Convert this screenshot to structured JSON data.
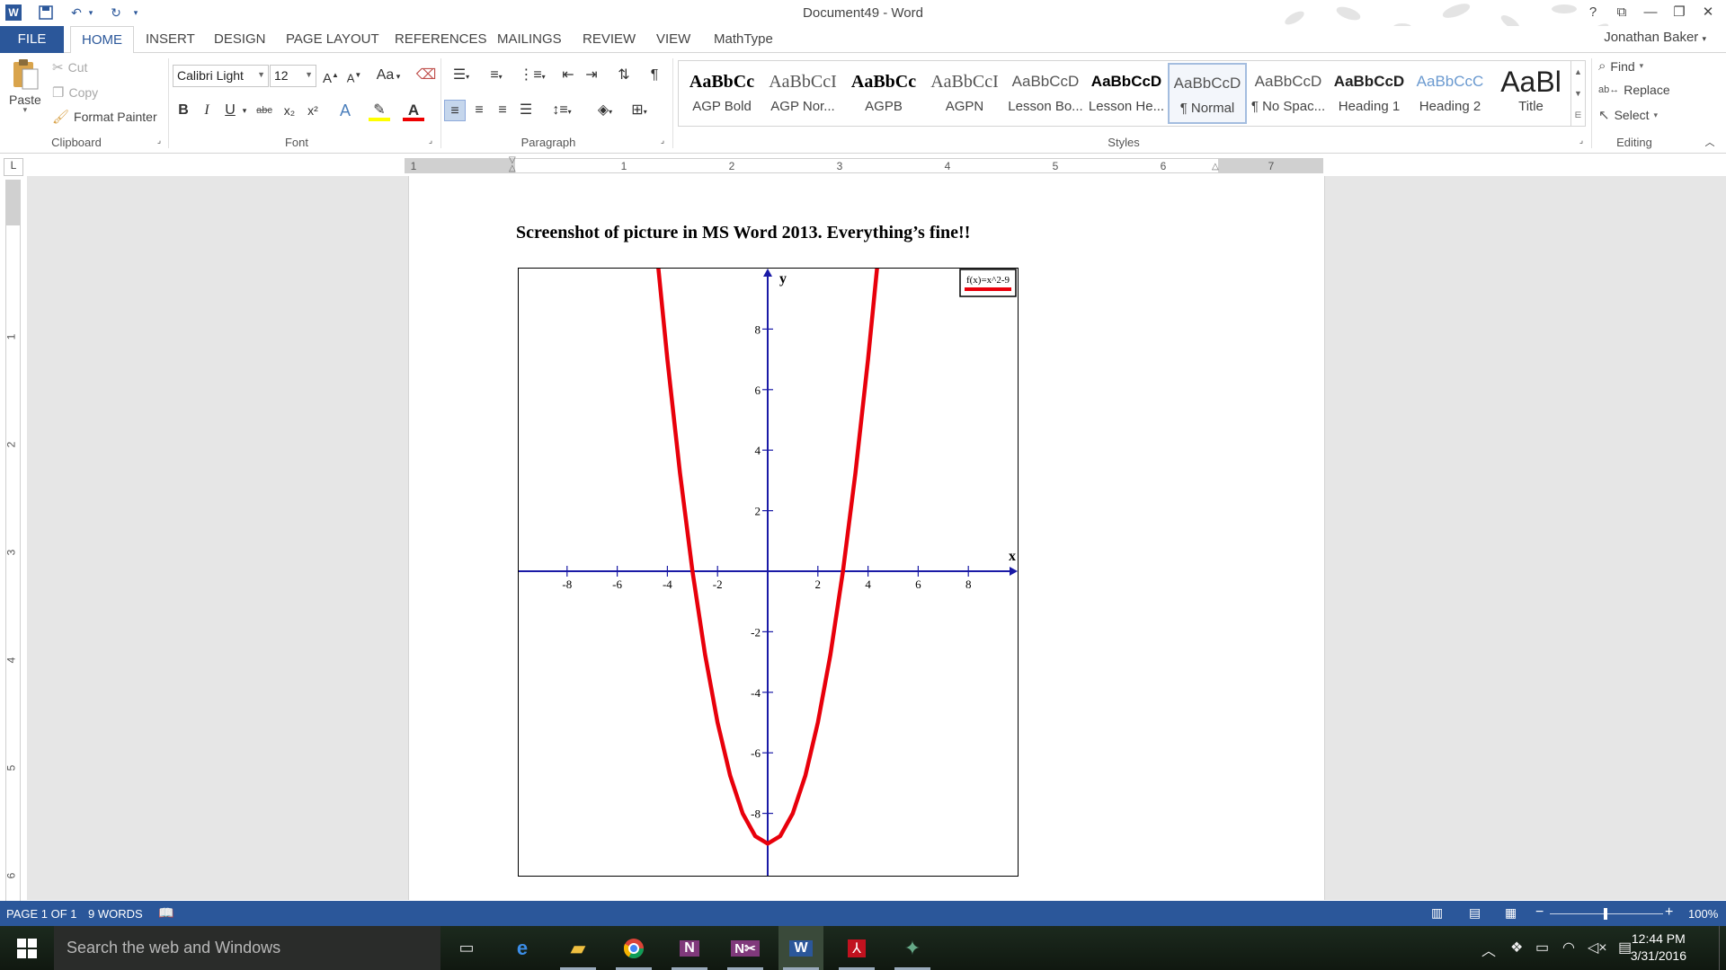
{
  "window": {
    "title": "Document49 - Word",
    "controls": [
      "?",
      "⧉",
      "—",
      "❐",
      "✕"
    ]
  },
  "tabs": {
    "file": "FILE",
    "items": [
      "HOME",
      "INSERT",
      "DESIGN",
      "PAGE LAYOUT",
      "REFERENCES",
      "MAILINGS",
      "REVIEW",
      "VIEW",
      "MathType"
    ],
    "active": "HOME",
    "user": "Jonathan Baker"
  },
  "clipboard": {
    "paste": "Paste",
    "cut": "Cut",
    "copy": "Copy",
    "format_painter": "Format Painter",
    "label": "Clipboard"
  },
  "font": {
    "name": "Calibri Light",
    "size": "12",
    "label": "Font",
    "case_btn": "Aa",
    "grow": "A",
    "shrink": "A",
    "bold": "B",
    "italic": "I",
    "underline": "U",
    "strike": "abc",
    "sub": "x₂",
    "sup": "x²"
  },
  "paragraph": {
    "label": "Paragraph"
  },
  "styles": {
    "label": "Styles",
    "items": [
      {
        "preview": "AaBbCc",
        "name": "AGP Bold"
      },
      {
        "preview": "AaBbCcI",
        "name": "AGP Nor..."
      },
      {
        "preview": "AaBbCc",
        "name": "AGPB"
      },
      {
        "preview": "AaBbCcI",
        "name": "AGPN"
      },
      {
        "preview": "AaBbCcD",
        "name": "Lesson Bo..."
      },
      {
        "preview": "AaBbCcD",
        "name": "Lesson He..."
      },
      {
        "preview": "AaBbCcD",
        "name": "¶ Normal"
      },
      {
        "preview": "AaBbCcD",
        "name": "¶ No Spac..."
      },
      {
        "preview": "AaBbCcD",
        "name": "Heading 1"
      },
      {
        "preview": "AaBbCcC",
        "name": "Heading 2"
      },
      {
        "preview": "AaBl",
        "name": "Title"
      }
    ],
    "selected": "¶ Normal"
  },
  "editing": {
    "find": "Find",
    "replace": "Replace",
    "select": "Select",
    "label": "Editing"
  },
  "ruler": {
    "h_numbers": [
      "1",
      "1",
      "2",
      "3",
      "4",
      "5",
      "6",
      "7"
    ],
    "v_numbers": [
      "1",
      "2",
      "3",
      "4",
      "5",
      "6"
    ],
    "corner": "L"
  },
  "document": {
    "heading": "Screenshot of picture in MS Word 2013. Everything’s fine!!"
  },
  "chart_data": {
    "type": "line",
    "function": "f(x)=x^2-9",
    "legend": "f(x)=x^2-9",
    "legend_placement": "top-right",
    "xlabel": "x",
    "ylabel": "y",
    "xlim": [
      -10,
      10
    ],
    "ylim": [
      -10,
      10
    ],
    "x_ticks": [
      -8,
      -6,
      -4,
      -2,
      2,
      4,
      6,
      8
    ],
    "y_ticks": [
      -8,
      -6,
      -4,
      -2,
      2,
      4,
      6,
      8
    ],
    "series": [
      {
        "name": "f(x)=x^2-9",
        "color": "#e8000b",
        "x": [
          -4.36,
          -4,
          -3.5,
          -3,
          -2.5,
          -2,
          -1.5,
          -1,
          -0.5,
          0,
          0.5,
          1,
          1.5,
          2,
          2.5,
          3,
          3.5,
          4,
          4.36
        ],
        "y": [
          10,
          7,
          3.25,
          0,
          -2.75,
          -5,
          -6.75,
          -8,
          -8.75,
          -9,
          -8.75,
          -8,
          -6.75,
          -5,
          -2.75,
          0,
          3.25,
          7,
          10
        ]
      }
    ],
    "axis_color": "#1a1aa6",
    "grid": false
  },
  "status": {
    "page": "PAGE 1 OF 1",
    "words": "9 WORDS",
    "zoom": "100%"
  },
  "taskbar": {
    "search_placeholder": "Search the web and Windows",
    "time": "12:44 PM",
    "date": "3/31/2016"
  }
}
